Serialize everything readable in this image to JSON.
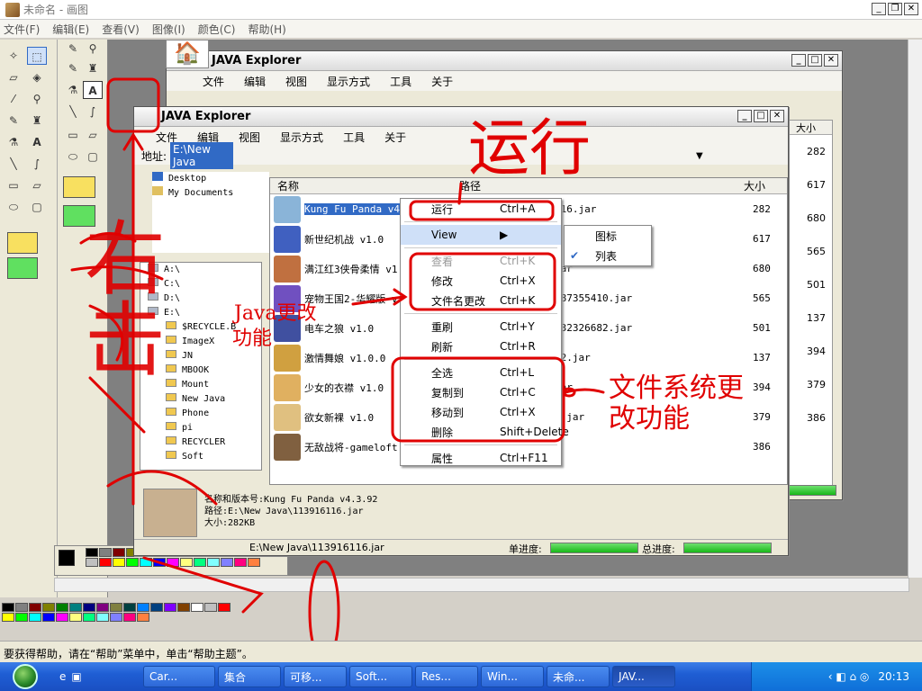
{
  "paint": {
    "title": "未命名 - 画图",
    "menu": [
      "文件(F)",
      "编辑(E)",
      "查看(V)",
      "图像(I)",
      "颜色(C)",
      "帮助(H)"
    ],
    "status_text": "要获得帮助，请在“帮助”菜单中，单击“帮助主题”。"
  },
  "back_window": {
    "title": "JAVA Explorer",
    "menu": [
      "文件",
      "编辑",
      "视图",
      "显示方式",
      "工具",
      "关于"
    ],
    "size_header": "大小",
    "sizes": [
      "282",
      "617",
      "680",
      "565",
      "501",
      "137",
      "394",
      "379",
      "386"
    ]
  },
  "front_window": {
    "title": "JAVA Explorer",
    "menu": [
      "文件",
      "编辑",
      "视图",
      "显示方式",
      "工具",
      "关于"
    ],
    "address_label": "地址:",
    "address_value": "E:\\New Java",
    "tree_top": [
      "Desktop",
      "My Documents"
    ],
    "tree_drives": [
      "A:\\",
      "C:\\",
      "D:\\",
      "E:\\",
      "$RECYCLE.B",
      "ImageX",
      "JN",
      "MBOOK",
      "Mount",
      "New Java",
      "Phone",
      "pi",
      "RECYCLER",
      "Soft"
    ],
    "col_name": "名称",
    "col_path": "路径",
    "col_size": "大小",
    "files": [
      {
        "name": "Kung Fu Panda v4.3",
        "path": "116.jar",
        "size": "282",
        "selected": true,
        "color": "#8ab4d8"
      },
      {
        "name": "新世纪机战 v1.0",
        "path": "",
        "size": "617",
        "color": "#4060c0"
      },
      {
        "name": "满江红3侠骨柔情 v1",
        "path": "jar",
        "size": "680",
        "color": "#c07040"
      },
      {
        "name": "宠物王国2-华耀版 v",
        "path": "287355410.jar",
        "size": "565",
        "color": "#7050c0"
      },
      {
        "name": "电车之狼 v1.0",
        "path": "132326682.jar",
        "size": "501",
        "color": "#4050a0"
      },
      {
        "name": "激情舞娘 v1.0.0",
        "path": "02.jar",
        "size": "137",
        "color": "#d0a040"
      },
      {
        "name": "少女的衣襟 v1.0",
        "path": "jar",
        "size": "394",
        "color": "#e0b060"
      },
      {
        "name": "欲女新裸 v1.0",
        "path": "5.jar",
        "size": "379",
        "color": "#e0c080"
      },
      {
        "name": "无敌战将-gameloft",
        "path": "",
        "size": "386",
        "color": "#806040"
      }
    ],
    "info_name": "名称和版本号:Kung Fu Panda v4.3.92",
    "info_path": "路径:E:\\New Java\\113916116.jar",
    "info_size": "大小:282KB",
    "status_path": "E:\\New Java\\113916116.jar",
    "single_progress": "单进度:",
    "total_progress": "总进度:"
  },
  "context_menu": {
    "items": [
      {
        "label": "运行",
        "key": "Ctrl+A"
      },
      {
        "label": "View",
        "key": "▶"
      },
      {
        "label": "查看",
        "key": "Ctrl+K"
      },
      {
        "label": "修改",
        "key": "Ctrl+X"
      },
      {
        "label": "文件名更改",
        "key": "Ctrl+K"
      },
      {
        "label": "重刷",
        "key": "Ctrl+Y"
      },
      {
        "label": "刷新",
        "key": "Ctrl+R"
      },
      {
        "label": "全选",
        "key": "Ctrl+L"
      },
      {
        "label": "复制到",
        "key": "Ctrl+C"
      },
      {
        "label": "移动到",
        "key": "Ctrl+X"
      },
      {
        "label": "删除",
        "key": "Shift+Delete"
      },
      {
        "label": "属性",
        "key": "Ctrl+F11"
      }
    ],
    "submenu": [
      "图标",
      "列表"
    ]
  },
  "annotations": {
    "run": "运行",
    "java_change": "Java更改",
    "java_change2": "功能",
    "fs_change": "文件系统更",
    "fs_change2": "改功能",
    "side_text": "右击"
  },
  "taskbar": {
    "buttons": [
      "Car...",
      "集合",
      "可移...",
      "Soft...",
      "Res...",
      "Win...",
      "未命...",
      "JAV..."
    ],
    "clock": "20:13"
  },
  "colors": {
    "annotation": "#e00000",
    "selection": "#316ac5",
    "progress": "#18b818"
  }
}
